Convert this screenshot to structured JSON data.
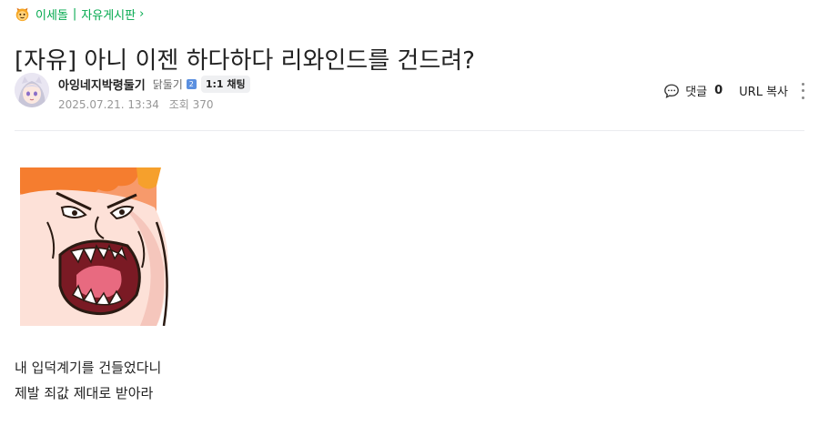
{
  "breadcrumb": {
    "cafe_name": "이세돌",
    "separator": "|",
    "board_name": "자유게시판",
    "chevron": "›"
  },
  "post": {
    "title": "[자유] 아니 이젠 하다하다 리와인드를 건드려?",
    "body_lines": [
      "내 입덕계기를 건들었다니",
      "제발 죄값 제대로 받아라"
    ]
  },
  "author": {
    "nickname": "아잉네지박령둘기",
    "grade": "닭둘기",
    "grade_badge": "2",
    "chat_label": "1:1 채팅",
    "date": "2025.07.21. 13:34",
    "views_label": "조회 370"
  },
  "actions": {
    "comment_label": "댓글",
    "comment_count": "0",
    "url_copy_label": "URL 복사"
  },
  "colors": {
    "accent": "#03a94e",
    "text": "#222222",
    "meta": "#979797",
    "divider": "#ebecef"
  },
  "icons": {
    "cafe": "cafe-emoji-icon",
    "comment": "speech-bubble-icon",
    "more": "vertical-dots-icon"
  }
}
